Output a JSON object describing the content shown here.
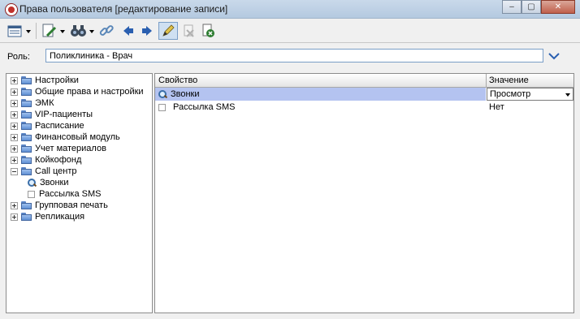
{
  "window": {
    "title": "Права пользователя [редактирование записи]",
    "controls": {
      "minimize": "–",
      "maximize": "▢",
      "close": "✕"
    }
  },
  "toolbar": {
    "icons": [
      "view-menu-icon",
      "edit-document-icon",
      "binoculars-icon",
      "link-icon",
      "arrow-left-icon",
      "arrow-right-icon",
      "edit-pencil-icon",
      "delete-icon",
      "exit-icon"
    ],
    "pressed": "edit-pencil-icon"
  },
  "role": {
    "label": "Роль:",
    "value": "Поликлиника - Врач"
  },
  "tree": {
    "items": [
      {
        "label": "Настройки",
        "expander": "plus",
        "icon": "folder"
      },
      {
        "label": "Общие права и настройки",
        "expander": "plus",
        "icon": "folder"
      },
      {
        "label": "ЭМК",
        "expander": "plus",
        "icon": "folder"
      },
      {
        "label": "VIP-пациенты",
        "expander": "plus",
        "icon": "folder"
      },
      {
        "label": "Расписание",
        "expander": "plus",
        "icon": "folder"
      },
      {
        "label": "Финансовый модуль",
        "expander": "plus",
        "icon": "folder"
      },
      {
        "label": "Учет материалов",
        "expander": "plus",
        "icon": "folder"
      },
      {
        "label": "Койкофонд",
        "expander": "plus",
        "icon": "folder"
      },
      {
        "label": "Call центр",
        "expander": "minus",
        "icon": "folder"
      },
      {
        "label": "Звонки",
        "expander": "none",
        "icon": "magnifier"
      },
      {
        "label": "Рассылка SMS",
        "expander": "none",
        "icon": "checkbox"
      },
      {
        "label": "Групповая печать",
        "expander": "plus",
        "icon": "folder"
      },
      {
        "label": "Репликация",
        "expander": "plus",
        "icon": "folder"
      }
    ]
  },
  "grid": {
    "columns": [
      "Свойство",
      "Значение"
    ],
    "rows": [
      {
        "property": "Звонки",
        "value": "Просмотр",
        "icon": "magnifier",
        "selected": true
      },
      {
        "property": "Рассылка SMS",
        "value": "Нет",
        "icon": "checkbox",
        "selected": false
      }
    ]
  },
  "colors": {
    "selection": "#b4c3f0",
    "border": "#8c8c8c",
    "accent": "#3a6ea8"
  }
}
